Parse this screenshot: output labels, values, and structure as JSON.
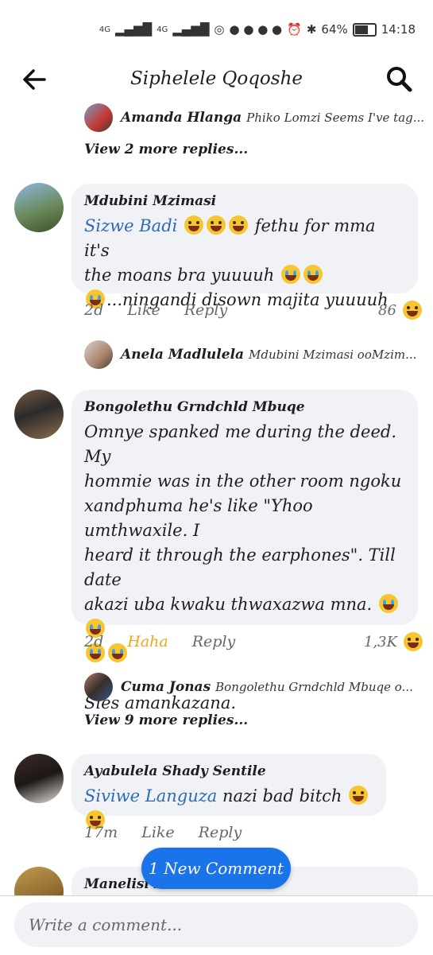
{
  "status_bar": {
    "network_1": "4G",
    "network_2": "4G",
    "battery": "64%",
    "time": "14:18"
  },
  "header": {
    "title": "Siphelele Qoqoshe"
  },
  "comments": [
    {
      "reply_preview": {
        "name": "Amanda Hlanga",
        "text": "Phiko Lomzi Seems I've tag..."
      },
      "view_more": "View 2 more replies..."
    },
    {
      "author": "Mdubini Mzimasi",
      "mention": "Sizwe Badi",
      "line1_after": " fethu for mma it's",
      "line2": "the moans bra yuuuuh",
      "line3": "...ningandi disown majita yuuuuh",
      "time": "2d",
      "like": "Like",
      "reply": "Reply",
      "reaction_count": "86",
      "reply_preview": {
        "name": "Anela Madlulela",
        "text": "Mdubini Mzimasi ooMzim..."
      }
    },
    {
      "author": "Bongolethu Grndchld Mbuqe",
      "line1": "Omnye spanked me during the deed. My",
      "line2": "hommie was in the other room ngoku",
      "line3": "xandphuma he's like \"Yhoo umthwaxile. I",
      "line4": "heard it through the earphones\". Till date",
      "line5": "akazi uba kwaku thwaxazwa mna.",
      "line7": "Sies amankazana.",
      "time": "2d",
      "haha": "Haha",
      "reply": "Reply",
      "reaction_count": "1,3K",
      "reply_preview": {
        "name": "Cuma Jonas",
        "text": "Bongolethu Grndchld Mbuqe o..."
      },
      "view_more": "View 9 more replies..."
    },
    {
      "author": "Ayabulela Shady Sentile",
      "mention": "Siviwe Languza",
      "text_after": " nazi bad bitch",
      "time": "17m",
      "like": "Like",
      "reply": "Reply"
    },
    {
      "author": "Manelisi Faltein"
    }
  ],
  "new_comment_pill": "1 New Comment",
  "composer": {
    "placeholder": "Write a comment..."
  },
  "icons": [
    "back-arrow-icon",
    "search-icon",
    "laughing-emoji-icon",
    "crying-emoji-icon"
  ]
}
